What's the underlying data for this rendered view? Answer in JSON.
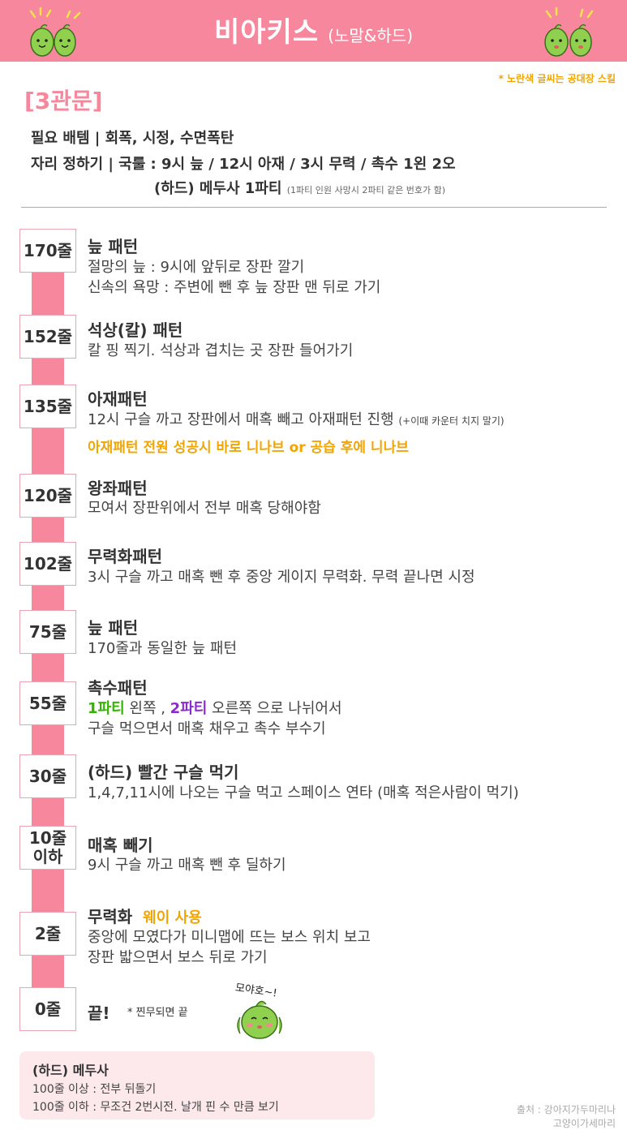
{
  "header": {
    "title": "비아키스",
    "subtitle": "(노말&하드)"
  },
  "skill_note": "* 노란색 글씨는 공대장 스킬",
  "phase": "[3관문]",
  "info": {
    "items": "필요 배템  |  회폭, 시정, 수면폭탄",
    "positions": "자리 정하기  |  국룰 : 9시 늪 / 12시 아재 / 3시 무력 / 촉수 1왼 2오",
    "hard_party": "(하드) 메두사 1파티",
    "hard_party_note": "(1파티 인원 사망시 2파티 같은 번호가 함)"
  },
  "steps": [
    {
      "hp": "170줄",
      "title": "늪 패턴",
      "lines": [
        "절망의 늪 : 9시에 앞뒤로 장판 깔기",
        "신속의 욕망 : 주변에 뺀 후 늪 장판 맨 뒤로 가기"
      ]
    },
    {
      "hp": "152줄",
      "title": "석상(칼) 패턴",
      "lines": [
        "칼 핑 찍기. 석상과 겹치는 곳 장판 들어가기"
      ]
    },
    {
      "hp": "135줄",
      "title": "아재패턴",
      "line1": "12시 구슬 까고 장판에서 매혹 빼고 아재패턴 진행",
      "line1_note": "(+이때 카운터 치지 말기)",
      "leader": "아재패턴 전원 성공시 바로 니나브 or 공습 후에 니나브"
    },
    {
      "hp": "120줄",
      "title": "왕좌패턴",
      "lines": [
        "모여서 장판위에서 전부 매혹 당해야함"
      ]
    },
    {
      "hp": "102줄",
      "title": "무력화패턴",
      "lines": [
        "3시 구슬 까고 매혹 뺀 후 중앙 게이지 무력화. 무력 끝나면 시정"
      ]
    },
    {
      "hp": "75줄",
      "title": "늪 패턴",
      "lines": [
        "170줄과 동일한 늪 패턴"
      ]
    },
    {
      "hp": "55줄",
      "title": "촉수패턴",
      "party1": "1파티",
      "party1_text": " 왼쪽 , ",
      "party2": "2파티",
      "party2_text": " 오른쪽 으로 나뉘어서",
      "line2": "구슬 먹으면서 매혹 채우고 촉수 부수기"
    },
    {
      "hp": "30줄",
      "title": "(하드) 빨간 구슬 먹기",
      "lines": [
        "1,4,7,11시에 나오는 구슬 먹고 스페이스 연타 (매혹 적은사람이 먹기)"
      ]
    },
    {
      "hp_line1": "10줄",
      "hp_line2": "이하",
      "title": "매혹 빼기",
      "lines": [
        "9시 구슬 까고 매혹 뺀 후 딜하기"
      ]
    },
    {
      "hp": "2줄",
      "title": "무력화",
      "title_skill": "웨이 사용",
      "lines": [
        "중앙에 모였다가 미니맵에 뜨는 보스 위치 보고",
        "장판 밟으면서 보스 뒤로 가기"
      ]
    },
    {
      "hp": "0줄",
      "title": "끝!",
      "note": "* 찐무되면 끝",
      "speech": "모야호~!"
    }
  ],
  "medusa": {
    "title": "(하드) 메두사",
    "line1": "100줄 이상 : 전부 뒤돌기",
    "line2": "100줄 이하 : 무조건 2번시전. 날개 핀 수 만큼 보기"
  },
  "credit": {
    "line1": "출처 : 강아지가두마리나",
    "line2": "고양이가세마리"
  },
  "colors": {
    "accent": "#f7879d",
    "leader_skill": "#f0a500",
    "party1": "#33b400",
    "party2": "#8c2ad2",
    "medusa_bg": "#fde9ec"
  },
  "icons": [
    "pear-mascot",
    "sparkle-lines"
  ]
}
